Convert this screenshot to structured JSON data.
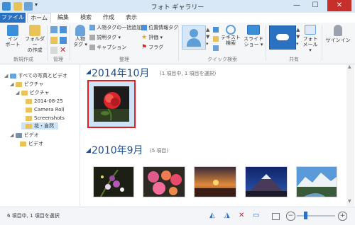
{
  "window": {
    "title": "フォト ギャラリー",
    "minimize": "—",
    "maximize": "☐",
    "close": "✕"
  },
  "tabs": [
    "ファイル",
    "ホーム",
    "編集",
    "検索",
    "作成",
    "表示"
  ],
  "ribbon": {
    "import_line1": "イン",
    "import_line2": "ポート",
    "folder_line1": "フォルダー",
    "folder_line2": "の作成",
    "group_new": "新規作成",
    "group_manage": "管理",
    "person_line1": "人物",
    "person_line2": "タグ ▾",
    "batch_tag": "人物タグの一括追加",
    "desc_tag": "説明タグ ▾",
    "caption": "キャプション",
    "geo_tag": "位置情報タグ",
    "rating": "評価 ▾",
    "flag": "フラグ",
    "group_organize": "整理",
    "group_quickfind": "クイック検索",
    "text_search_line1": "テキスト",
    "text_search_line2": "検索",
    "slideshow_line1": "スライド",
    "slideshow_line2": "ショー ▾",
    "photo_mail_line1": "フォト",
    "photo_mail_line2": "メール ▾",
    "signin": "サインイン",
    "group_share": "共有"
  },
  "sidebar": {
    "items": [
      {
        "label": "すべての写真とビデオ"
      },
      {
        "label": "ピクチャ"
      },
      {
        "label": "ピクチャ"
      },
      {
        "label": "2014-08-25"
      },
      {
        "label": "Camera Roll"
      },
      {
        "label": "Screenshots"
      },
      {
        "label": "花・自然"
      },
      {
        "label": "ビデオ"
      },
      {
        "label": "ビデオ"
      }
    ]
  },
  "groups": [
    {
      "title": "2014年10月",
      "note": "(1 項目中, 1 項目を選択)"
    },
    {
      "title": "2010年9月",
      "note": "(5 項目)"
    }
  ],
  "status": {
    "text": "6 項目中, 1 項目を選択"
  },
  "colors": {
    "accent": "#2a72c1",
    "selection": "#e01e26",
    "heading": "#1f4f8a"
  }
}
